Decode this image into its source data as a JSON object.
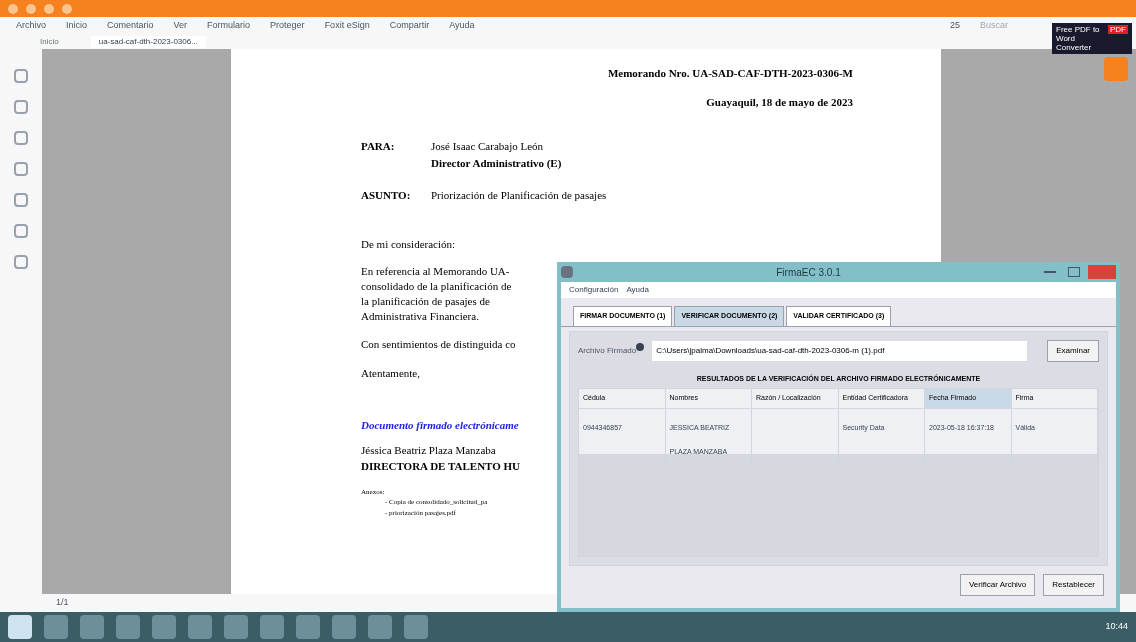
{
  "menu": [
    "Archivo",
    "Inicio",
    "Comentario",
    "Ver",
    "Formulario",
    "Proteger",
    "Foxit eSign",
    "Compartir",
    "Ayuda"
  ],
  "toolbar": {
    "zoom": "25",
    "search_placeholder": "Buscar",
    "ad": "Free PDF to Word Converter",
    "ad_badge": "PDF"
  },
  "doc_tabs": [
    {
      "label": "Inicio",
      "selected": false
    },
    {
      "label": "ua-sad-caf-dth-2023-0306...",
      "selected": true
    }
  ],
  "document": {
    "memo_number": "Memorando Nro. UA-SAD-CAF-DTH-2023-0306-M",
    "place_date": "Guayaquil, 18 de mayo de 2023",
    "to_label": "PARA:",
    "to_name": "José Isaac Carabajo León",
    "to_title": "Director Administrativo (E)",
    "subject_label": "ASUNTO:",
    "subject": "Priorización de Planificación de pasajes",
    "greeting": "De mi consideración:",
    "body": [
      "En referencia al Memorando UA-",
      "consolidado de la planificación de",
      "la planificación de pasajes de",
      "Administrativa Financiera."
    ],
    "closing_1": "Con sentimientos de distinguida co",
    "closing_2": "Atentamente,",
    "signed_note": "Documento firmado electrónicame",
    "signer": "Jéssica Beatriz Plaza Manzaba",
    "signer_title": "DIRECTORA DE TALENTO HU",
    "annex_label": "Anexos:",
    "annexes": [
      "- Copia de consolidado_solicitud_pa",
      "- priorización pasajes.pdf"
    ]
  },
  "status_bar": {
    "page": "1/1"
  },
  "dialog": {
    "title": "FirmaEC 3.0.1",
    "menu": [
      "Configuración",
      "Ayuda"
    ],
    "tabs": [
      {
        "label": "FIRMAR DOCUMENTO (1)",
        "selected": false
      },
      {
        "label": "VERIFICAR DOCUMENTO (2)",
        "selected": true
      },
      {
        "label": "VALIDAR CERTIFICADO (3)",
        "selected": false
      }
    ],
    "file_label": "Archivo Firmado",
    "file_value": "C:\\Users\\jpalma\\Downloads\\ua-sad-caf-dth-2023-0306-m (1).pdf",
    "browse_button": "Examinar",
    "results_title": "RESULTADOS DE LA VERIFICACIÓN DEL ARCHIVO FIRMADO ELECTRÓNICAMENTE",
    "table": {
      "columns": [
        "Cédula",
        "Nombres",
        "Razón / Localización",
        "Entidad Certificadora",
        "Fecha Firmado",
        "Firma"
      ],
      "rows": [
        [
          "0944346857",
          "JESSICA BEATRIZ PLAZA MANZABA",
          "",
          "Security Data",
          "2023-05-18 16:37:18",
          "Válida"
        ]
      ]
    },
    "buttons": [
      "Verificar Archivo",
      "Restablecer"
    ]
  },
  "taskbar": {
    "time": "10:44"
  }
}
